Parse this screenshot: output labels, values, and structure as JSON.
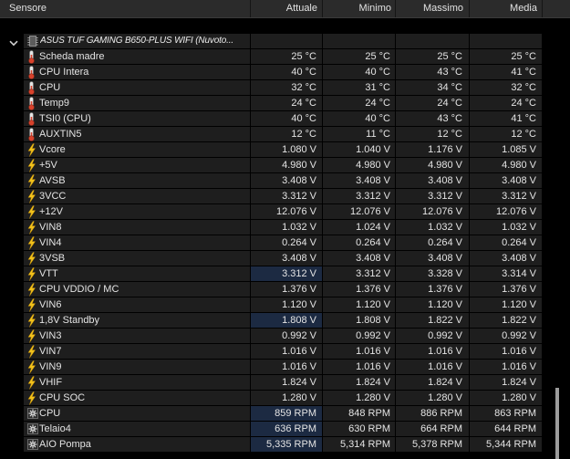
{
  "columns": {
    "sensor": "Sensore",
    "current": "Attuale",
    "min": "Minimo",
    "max": "Massimo",
    "avg": "Media"
  },
  "group": {
    "name": "ASUS TUF GAMING B650-PLUS WIFI (Nuvoto...",
    "icon": "chip-icon",
    "expand_icon": "chevron-down-icon"
  },
  "colors": {
    "background": "#000000",
    "row": "#1e1e1e",
    "header": "#2b2b2b",
    "highlight": "#1c2a42",
    "text": "#e4e4e4"
  },
  "rows": [
    {
      "label": "Scheda madre",
      "icon": "thermometer-icon",
      "current": "25 °C",
      "min": "25 °C",
      "max": "25 °C",
      "avg": "25 °C",
      "current_highlighted": false
    },
    {
      "label": "CPU Intera",
      "icon": "thermometer-icon",
      "current": "40 °C",
      "min": "40 °C",
      "max": "43 °C",
      "avg": "41 °C",
      "current_highlighted": false
    },
    {
      "label": "CPU",
      "icon": "thermometer-icon",
      "current": "32 °C",
      "min": "31 °C",
      "max": "34 °C",
      "avg": "32 °C",
      "current_highlighted": false
    },
    {
      "label": "Temp9",
      "icon": "thermometer-icon",
      "current": "24 °C",
      "min": "24 °C",
      "max": "24 °C",
      "avg": "24 °C",
      "current_highlighted": false
    },
    {
      "label": "TSI0 (CPU)",
      "icon": "thermometer-icon",
      "current": "40 °C",
      "min": "40 °C",
      "max": "43 °C",
      "avg": "41 °C",
      "current_highlighted": false
    },
    {
      "label": "AUXTIN5",
      "icon": "thermometer-icon",
      "current": "12 °C",
      "min": "11 °C",
      "max": "12 °C",
      "avg": "12 °C",
      "current_highlighted": false
    },
    {
      "label": "Vcore",
      "icon": "lightning-bolt-icon",
      "current": "1.080 V",
      "min": "1.040 V",
      "max": "1.176 V",
      "avg": "1.085 V",
      "current_highlighted": false
    },
    {
      "label": "+5V",
      "icon": "lightning-bolt-icon",
      "current": "4.980 V",
      "min": "4.980 V",
      "max": "4.980 V",
      "avg": "4.980 V",
      "current_highlighted": false
    },
    {
      "label": "AVSB",
      "icon": "lightning-bolt-icon",
      "current": "3.408 V",
      "min": "3.408 V",
      "max": "3.408 V",
      "avg": "3.408 V",
      "current_highlighted": false
    },
    {
      "label": "3VCC",
      "icon": "lightning-bolt-icon",
      "current": "3.312 V",
      "min": "3.312 V",
      "max": "3.312 V",
      "avg": "3.312 V",
      "current_highlighted": false
    },
    {
      "label": "+12V",
      "icon": "lightning-bolt-icon",
      "current": "12.076 V",
      "min": "12.076 V",
      "max": "12.076 V",
      "avg": "12.076 V",
      "current_highlighted": false
    },
    {
      "label": "VIN8",
      "icon": "lightning-bolt-icon",
      "current": "1.032 V",
      "min": "1.024 V",
      "max": "1.032 V",
      "avg": "1.032 V",
      "current_highlighted": false
    },
    {
      "label": "VIN4",
      "icon": "lightning-bolt-icon",
      "current": "0.264 V",
      "min": "0.264 V",
      "max": "0.264 V",
      "avg": "0.264 V",
      "current_highlighted": false
    },
    {
      "label": "3VSB",
      "icon": "lightning-bolt-icon",
      "current": "3.408 V",
      "min": "3.408 V",
      "max": "3.408 V",
      "avg": "3.408 V",
      "current_highlighted": false
    },
    {
      "label": "VTT",
      "icon": "lightning-bolt-icon",
      "current": "3.312 V",
      "min": "3.312 V",
      "max": "3.328 V",
      "avg": "3.314 V",
      "current_highlighted": true
    },
    {
      "label": "CPU VDDIO / MC",
      "icon": "lightning-bolt-icon",
      "current": "1.376 V",
      "min": "1.376 V",
      "max": "1.376 V",
      "avg": "1.376 V",
      "current_highlighted": false
    },
    {
      "label": "VIN6",
      "icon": "lightning-bolt-icon",
      "current": "1.120 V",
      "min": "1.120 V",
      "max": "1.120 V",
      "avg": "1.120 V",
      "current_highlighted": false
    },
    {
      "label": "1,8V Standby",
      "icon": "lightning-bolt-icon",
      "current": "1.808 V",
      "min": "1.808 V",
      "max": "1.822 V",
      "avg": "1.822 V",
      "current_highlighted": true
    },
    {
      "label": "VIN3",
      "icon": "lightning-bolt-icon",
      "current": "0.992 V",
      "min": "0.992 V",
      "max": "0.992 V",
      "avg": "0.992 V",
      "current_highlighted": false
    },
    {
      "label": "VIN7",
      "icon": "lightning-bolt-icon",
      "current": "1.016 V",
      "min": "1.016 V",
      "max": "1.016 V",
      "avg": "1.016 V",
      "current_highlighted": false
    },
    {
      "label": "VIN9",
      "icon": "lightning-bolt-icon",
      "current": "1.016 V",
      "min": "1.016 V",
      "max": "1.016 V",
      "avg": "1.016 V",
      "current_highlighted": false
    },
    {
      "label": "VHIF",
      "icon": "lightning-bolt-icon",
      "current": "1.824 V",
      "min": "1.824 V",
      "max": "1.824 V",
      "avg": "1.824 V",
      "current_highlighted": false
    },
    {
      "label": "CPU SOC",
      "icon": "lightning-bolt-icon",
      "current": "1.280 V",
      "min": "1.280 V",
      "max": "1.280 V",
      "avg": "1.280 V",
      "current_highlighted": false
    },
    {
      "label": "CPU",
      "icon": "fan-icon",
      "current": "859 RPM",
      "min": "848 RPM",
      "max": "886 RPM",
      "avg": "863 RPM",
      "current_highlighted": true
    },
    {
      "label": "Telaio4",
      "icon": "fan-icon",
      "current": "636 RPM",
      "min": "630 RPM",
      "max": "664 RPM",
      "avg": "644 RPM",
      "current_highlighted": true
    },
    {
      "label": "AIO Pompa",
      "icon": "fan-icon",
      "current": "5,335 RPM",
      "min": "5,314 RPM",
      "max": "5,378 RPM",
      "avg": "5,344 RPM",
      "current_highlighted": true
    }
  ]
}
